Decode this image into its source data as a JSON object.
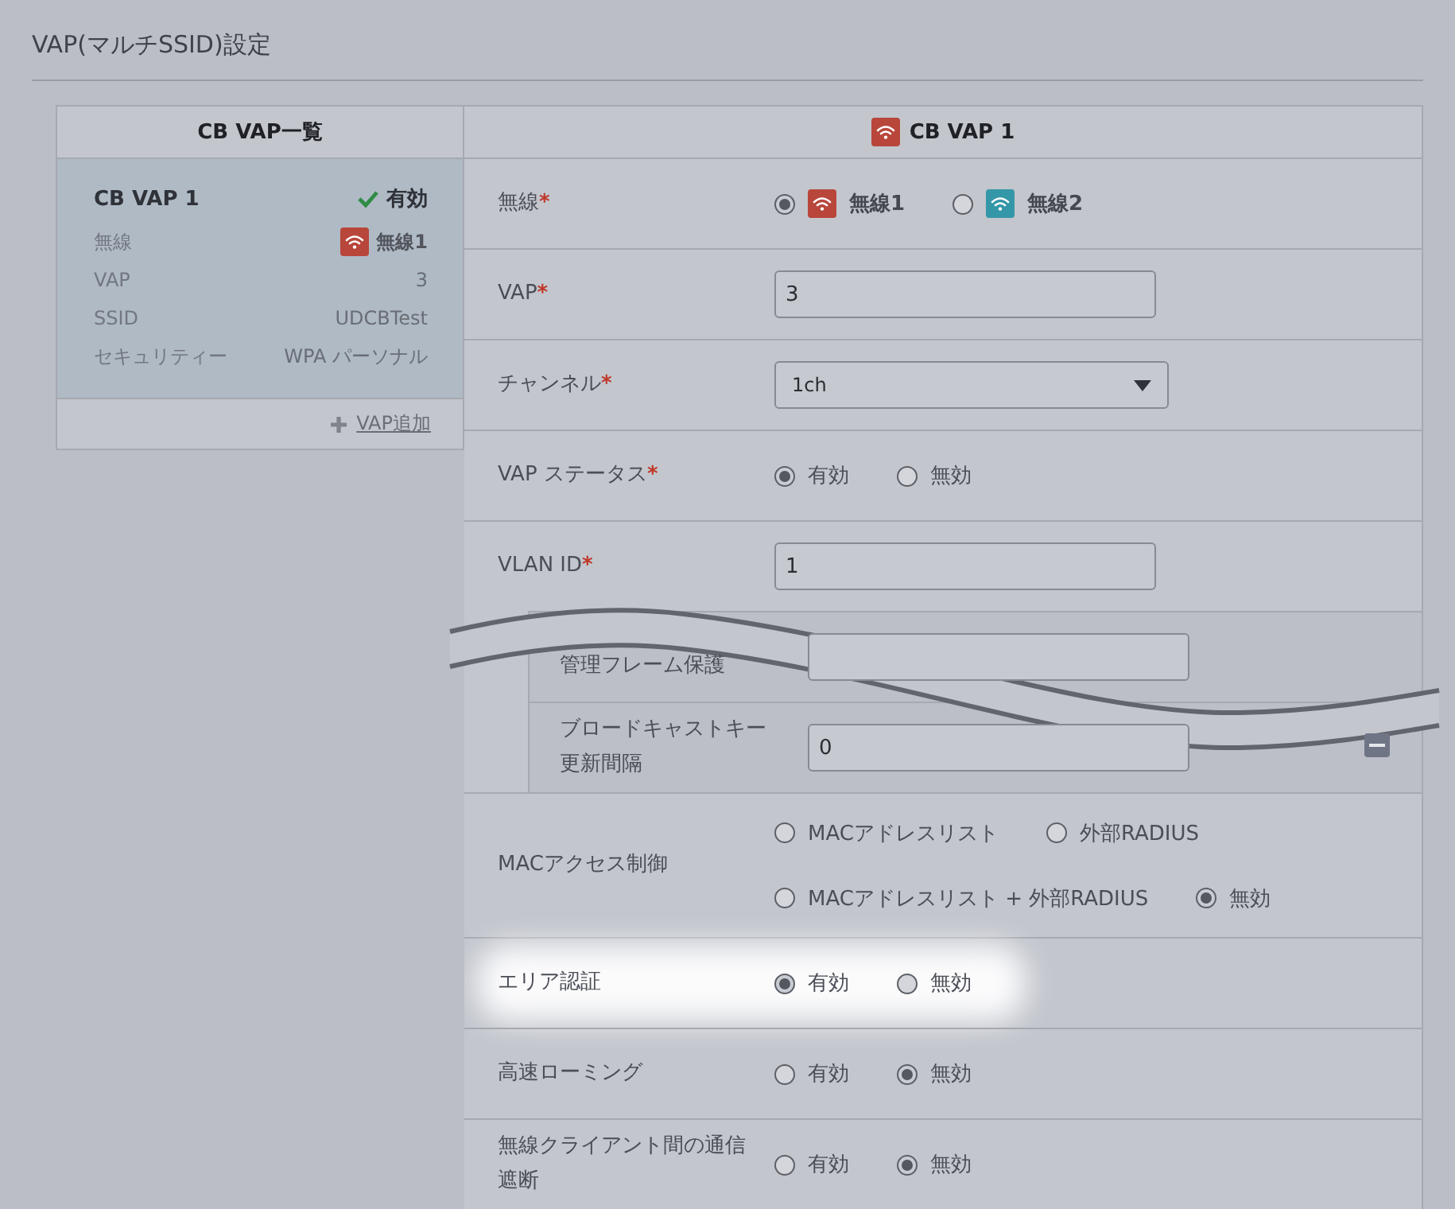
{
  "page": {
    "title": "VAP(マルチSSID)設定"
  },
  "vap_list": {
    "title": "CB VAP一覧",
    "add_link": "VAP追加",
    "items": [
      {
        "name": "CB VAP 1",
        "status": "有効",
        "enabled": true,
        "selected": true,
        "fields": [
          {
            "label": "無線",
            "value": "無線1",
            "color": "#b9463b"
          },
          {
            "label": "VAP",
            "value": "3"
          },
          {
            "label": "SSID",
            "value": "UDCBTest"
          },
          {
            "label": "セキュリティー",
            "value": "WPA パーソナル"
          }
        ]
      }
    ]
  },
  "editor": {
    "title": "CB VAP 1",
    "color": "#b9463b",
    "rows": [
      {
        "kind": "radio",
        "label": "無線",
        "required_mark": "*",
        "options": [
          {
            "label": "無線1",
            "selected": true,
            "color": "#b9463b"
          },
          {
            "label": "無線2",
            "selected": false,
            "color": "#3497a8"
          }
        ]
      },
      {
        "kind": "text",
        "label": "VAP",
        "required_mark": "*",
        "value": "3"
      },
      {
        "kind": "select",
        "label": "チャンネル",
        "required_mark": "*",
        "value": "1ch"
      },
      {
        "kind": "radio",
        "label": "VAP ステータス",
        "required_mark": "*",
        "options": [
          {
            "label": "有効",
            "selected": true
          },
          {
            "label": "無効",
            "selected": false
          }
        ]
      },
      {
        "kind": "text",
        "label": "VLAN ID",
        "required_mark": "*",
        "value": "1"
      },
      {
        "kind": "text",
        "label": "管理フレーム保護",
        "sub": true
      },
      {
        "kind": "text",
        "label": "ブロードキャストキー更新間隔",
        "sub": true,
        "value": "0",
        "removable": true
      },
      {
        "kind": "radio",
        "label": "MACアクセス制御",
        "options": [
          {
            "label": "MACアドレスリスト",
            "selected": false
          },
          {
            "label": "外部RADIUS",
            "selected": false
          },
          {
            "label": "MACアドレスリスト + 外部RADIUS",
            "selected": false
          },
          {
            "label": "無効",
            "selected": true
          }
        ]
      },
      {
        "kind": "radio",
        "label": "エリア認証",
        "highlight": true,
        "options": [
          {
            "label": "有効",
            "selected": true
          },
          {
            "label": "無効",
            "selected": false
          }
        ]
      },
      {
        "kind": "radio",
        "label": "高速ローミング",
        "options": [
          {
            "label": "有効",
            "selected": false
          },
          {
            "label": "無効",
            "selected": true
          }
        ]
      },
      {
        "kind": "radio",
        "label": "無線クライアント間の通信遮断",
        "options": [
          {
            "label": "有効",
            "selected": false
          },
          {
            "label": "無効",
            "selected": true
          }
        ]
      }
    ]
  }
}
